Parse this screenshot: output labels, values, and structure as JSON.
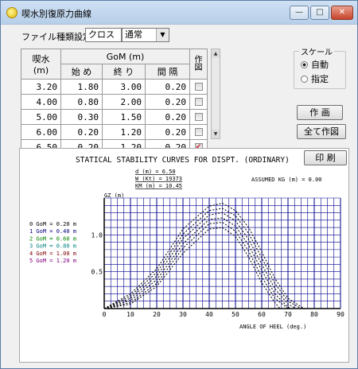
{
  "window": {
    "title": "喫水別復原力曲線",
    "minimize_glyph": "—",
    "maximize_glyph": "□",
    "close_glyph": "✕"
  },
  "filetype": {
    "label": "ファイル種類設定",
    "combo1_value": "クロス",
    "combo2_value": "通常"
  },
  "table": {
    "header_draft": "喫水(m)",
    "header_gom": "GoM (m)",
    "header_start": "始 め",
    "header_end": "終 り",
    "header_interval": "間 隔",
    "header_plot": "作図",
    "rows": [
      {
        "draft": "3.20",
        "start": "1.80",
        "end": "3.00",
        "interval": "0.20",
        "checked": false
      },
      {
        "draft": "4.00",
        "start": "0.80",
        "end": "2.00",
        "interval": "0.20",
        "checked": false
      },
      {
        "draft": "5.00",
        "start": "0.30",
        "end": "1.50",
        "interval": "0.20",
        "checked": false
      },
      {
        "draft": "6.00",
        "start": "0.20",
        "end": "1.20",
        "interval": "0.20",
        "checked": false
      },
      {
        "draft": "6.50",
        "start": "0.20",
        "end": "1.20",
        "interval": "0.20",
        "checked": true
      }
    ],
    "check_glyph": "✔"
  },
  "scale": {
    "title": "スケール",
    "options": [
      "自動",
      "指定"
    ],
    "selected": 0
  },
  "buttons": {
    "plot": "作 画",
    "plot_all": "全て作図",
    "print": "印 刷"
  },
  "chart_data": {
    "type": "line",
    "title": "STATICAL STABILITY CURVES FOR DISPT.  (ORDINARY)",
    "info": [
      "d (m) = 6.50",
      "W (Kt) = 19373",
      "KM (m) = 10.45"
    ],
    "assumed_kg": "ASSUMED KG (m) = 0.00",
    "ylabel": "GZ (m)",
    "xlabel": "ANGLE OF HEEL (deg.)",
    "xlim": [
      0,
      90
    ],
    "ylim": [
      0,
      1.5
    ],
    "x_ticks": [
      0,
      10,
      20,
      30,
      40,
      50,
      60,
      70,
      80,
      90
    ],
    "y_ticks": [
      "0.5",
      "1.0"
    ],
    "legend_position": "left",
    "colors": [
      "#000000",
      "#000080",
      "#008000",
      "#008080",
      "#800000",
      "#800080"
    ],
    "series": [
      {
        "name": "0 GoM = 0.20 m",
        "x": [
          0,
          10,
          20,
          30,
          40,
          45,
          50,
          55,
          60,
          65,
          67
        ],
        "y": [
          0,
          0.06,
          0.3,
          0.75,
          1.08,
          1.1,
          0.98,
          0.7,
          0.35,
          0.08,
          0
        ]
      },
      {
        "name": "1 GoM = 0.40 m",
        "x": [
          0,
          10,
          20,
          30,
          40,
          45,
          50,
          55,
          60,
          65,
          70
        ],
        "y": [
          0,
          0.08,
          0.34,
          0.82,
          1.15,
          1.17,
          1.05,
          0.78,
          0.43,
          0.14,
          0
        ]
      },
      {
        "name": "2 GoM = 0.60 m",
        "x": [
          0,
          10,
          20,
          30,
          40,
          45,
          50,
          55,
          60,
          65,
          70,
          71
        ],
        "y": [
          0,
          0.11,
          0.39,
          0.88,
          1.21,
          1.23,
          1.12,
          0.86,
          0.52,
          0.2,
          0.02,
          0
        ]
      },
      {
        "name": "3 GoM = 0.80 m",
        "x": [
          0,
          10,
          20,
          30,
          40,
          45,
          50,
          55,
          60,
          65,
          70,
          73
        ],
        "y": [
          0,
          0.14,
          0.44,
          0.95,
          1.27,
          1.3,
          1.19,
          0.94,
          0.6,
          0.27,
          0.06,
          0
        ]
      },
      {
        "name": "4 GoM = 1.00 m",
        "x": [
          0,
          10,
          20,
          30,
          40,
          45,
          50,
          55,
          60,
          65,
          70,
          75
        ],
        "y": [
          0,
          0.17,
          0.49,
          1.01,
          1.33,
          1.36,
          1.26,
          1.02,
          0.69,
          0.34,
          0.1,
          0
        ]
      },
      {
        "name": "5 GoM = 1.20 m",
        "x": [
          0,
          10,
          20,
          30,
          40,
          45,
          50,
          55,
          60,
          65,
          70,
          76
        ],
        "y": [
          0,
          0.2,
          0.54,
          1.08,
          1.39,
          1.43,
          1.33,
          1.1,
          0.77,
          0.41,
          0.14,
          0
        ]
      }
    ]
  }
}
